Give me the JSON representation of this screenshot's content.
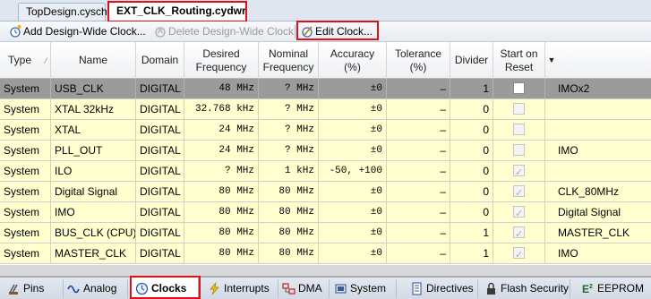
{
  "doc_tabs": [
    {
      "label": "TopDesign.cysch",
      "active": false
    },
    {
      "label": "EXT_CLK_Routing.cydwr",
      "active": true
    }
  ],
  "toolbar": {
    "add_label": "Add Design-Wide Clock...",
    "delete_label": "Delete Design-Wide Clock",
    "edit_label": "Edit Clock..."
  },
  "columns": {
    "type": "Type",
    "name": "Name",
    "domain": "Domain",
    "desired": "Desired\nFrequency",
    "nominal": "Nominal\nFrequency",
    "accuracy": "Accuracy\n(%)",
    "tolerance": "Tolerance\n(%)",
    "divider": "Divider",
    "start": "Start on\nReset",
    "source": ""
  },
  "rows": [
    {
      "type": "System",
      "name": "USB_CLK",
      "domain": "DIGITAL",
      "desired": "48 MHz",
      "nominal": "? MHz",
      "accuracy": "±0",
      "tolerance": "–",
      "divider": "1",
      "start": false,
      "source": "IMOx2",
      "selected": true
    },
    {
      "type": "System",
      "name": "XTAL 32kHz",
      "domain": "DIGITAL",
      "desired": "32.768 kHz",
      "nominal": "? MHz",
      "accuracy": "±0",
      "tolerance": "–",
      "divider": "0",
      "start": false,
      "source": "",
      "selected": false
    },
    {
      "type": "System",
      "name": "XTAL",
      "domain": "DIGITAL",
      "desired": "24 MHz",
      "nominal": "? MHz",
      "accuracy": "±0",
      "tolerance": "–",
      "divider": "0",
      "start": false,
      "source": "",
      "selected": false
    },
    {
      "type": "System",
      "name": "PLL_OUT",
      "domain": "DIGITAL",
      "desired": "24 MHz",
      "nominal": "? MHz",
      "accuracy": "±0",
      "tolerance": "–",
      "divider": "0",
      "start": false,
      "source": "IMO",
      "selected": false
    },
    {
      "type": "System",
      "name": "ILO",
      "domain": "DIGITAL",
      "desired": "? MHz",
      "nominal": "1 kHz",
      "accuracy": "-50, +100",
      "tolerance": "–",
      "divider": "0",
      "start": true,
      "source": "",
      "selected": false
    },
    {
      "type": "System",
      "name": "Digital Signal",
      "domain": "DIGITAL",
      "desired": "80 MHz",
      "nominal": "80 MHz",
      "accuracy": "±0",
      "tolerance": "–",
      "divider": "0",
      "start": true,
      "source": "CLK_80MHz",
      "selected": false
    },
    {
      "type": "System",
      "name": "IMO",
      "domain": "DIGITAL",
      "desired": "80 MHz",
      "nominal": "80 MHz",
      "accuracy": "±0",
      "tolerance": "–",
      "divider": "0",
      "start": true,
      "source": "Digital Signal",
      "selected": false
    },
    {
      "type": "System",
      "name": "BUS_CLK (CPU)",
      "domain": "DIGITAL",
      "desired": "80 MHz",
      "nominal": "80 MHz",
      "accuracy": "±0",
      "tolerance": "–",
      "divider": "1",
      "start": true,
      "source": "MASTER_CLK",
      "selected": false
    },
    {
      "type": "System",
      "name": "MASTER_CLK",
      "domain": "DIGITAL",
      "desired": "80 MHz",
      "nominal": "80 MHz",
      "accuracy": "±0",
      "tolerance": "–",
      "divider": "1",
      "start": true,
      "source": "IMO",
      "selected": false
    }
  ],
  "bottom_tabs": [
    {
      "label": "Pins",
      "icon": "pins-icon",
      "active": false
    },
    {
      "label": "Analog",
      "icon": "analog-wave-icon",
      "active": false
    },
    {
      "label": "Clocks",
      "icon": "clock-icon",
      "active": true
    },
    {
      "label": "Interrupts",
      "icon": "lightning-icon",
      "active": false
    },
    {
      "label": "DMA",
      "icon": "dma-icon",
      "active": false
    },
    {
      "label": "System",
      "icon": "system-icon",
      "active": false
    },
    {
      "label": "Directives",
      "icon": "directives-icon",
      "active": false
    },
    {
      "label": "Flash Security",
      "icon": "lock-icon",
      "active": false
    },
    {
      "label": "EEPROM",
      "icon": "eeprom-icon",
      "active": false
    }
  ],
  "colors": {
    "row_bg": "#ffffd0",
    "selected_row_bg": "#9b9b9b",
    "highlight_border": "#e0101a"
  }
}
